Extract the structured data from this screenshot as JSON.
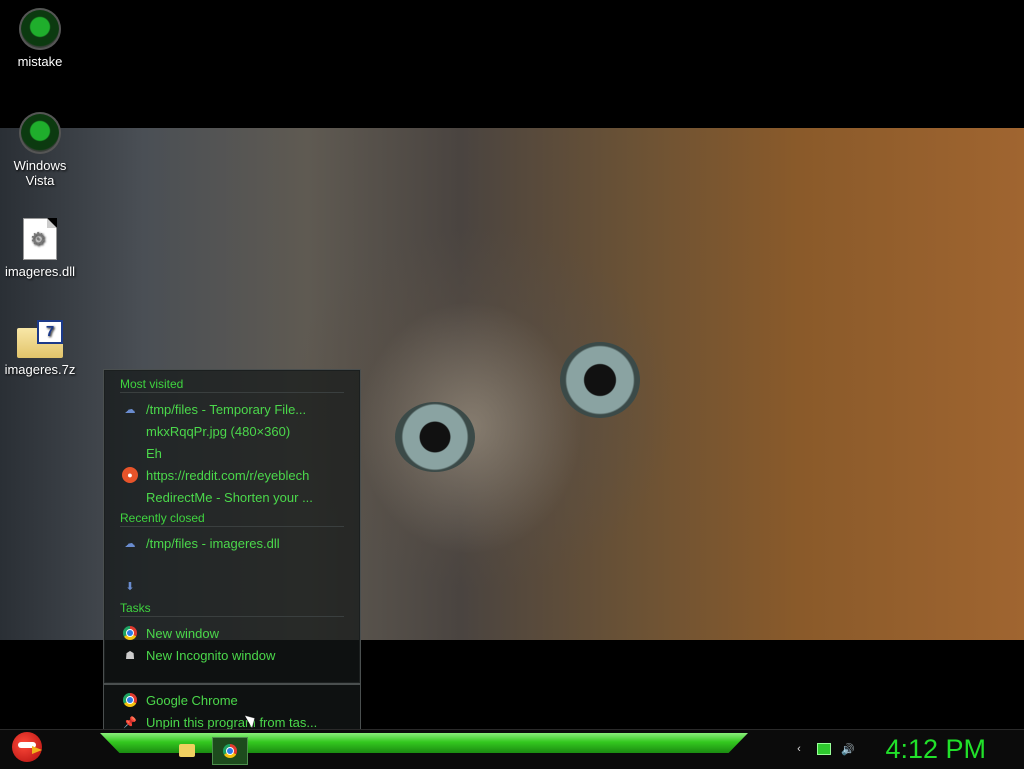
{
  "desktop": {
    "icons": [
      {
        "label": "mistake",
        "icon": "orb-icon"
      },
      {
        "label": "Windows Vista",
        "icon": "recycle-bin-icon"
      },
      {
        "label": "imageres.dll",
        "icon": "dll-file-icon"
      },
      {
        "label": "imageres.7z",
        "icon": "7z-archive-icon"
      }
    ]
  },
  "jumplist": {
    "most_visited_header": "Most visited",
    "most_visited": [
      "/tmp/files - Temporary File...",
      "mkxRqqPr.jpg (480×360)",
      "Eh",
      "https://reddit.com/r/eyeblech",
      "RedirectMe - Shorten your ..."
    ],
    "recently_closed_header": "Recently closed",
    "recently_closed": [
      "/tmp/files - imageres.dll"
    ],
    "tasks_header": "Tasks",
    "tasks": [
      "New window",
      "New Incognito window"
    ],
    "app_name": "Google Chrome",
    "unpin_label": "Unpin this program from tas..."
  },
  "taskbar": {
    "clock": "4:12 PM",
    "pinned": [
      "folder-icon",
      "chrome-icon"
    ]
  },
  "colors": {
    "accent_green": "#3fd43f",
    "clock_green": "#21e12a"
  }
}
